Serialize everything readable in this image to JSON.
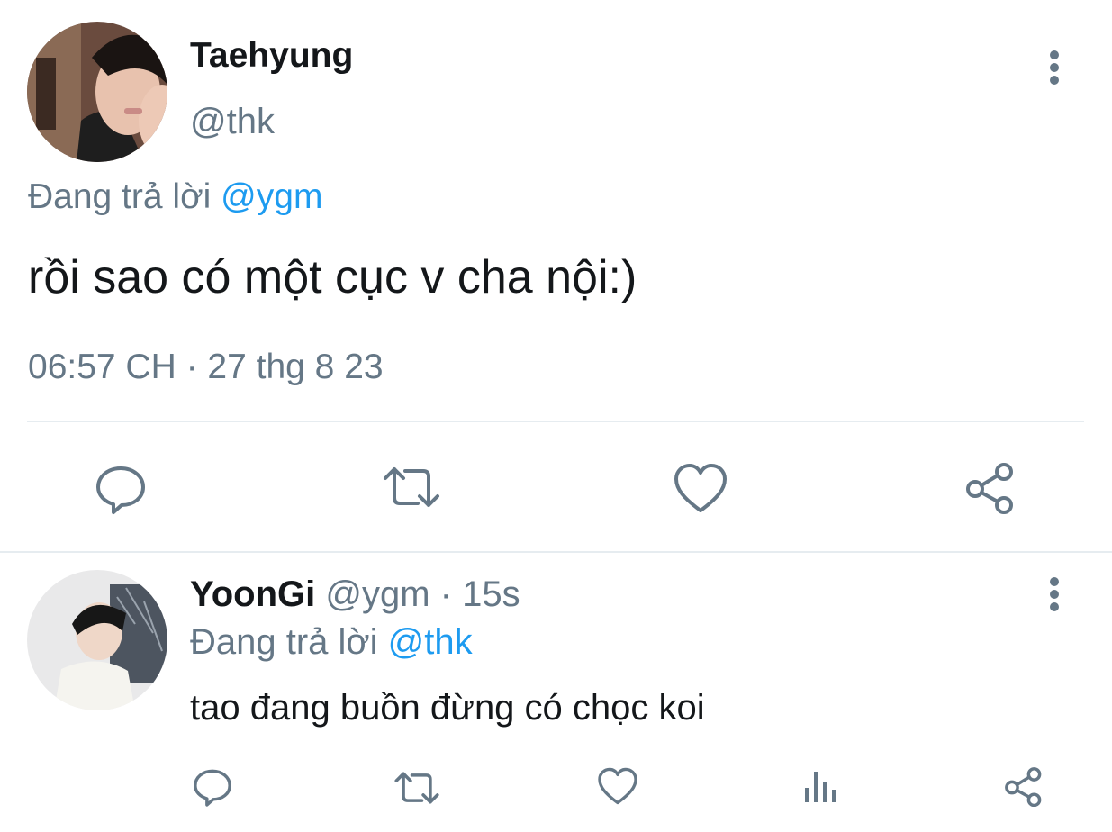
{
  "main_tweet": {
    "display_name": "Taehyung",
    "handle": "@thk",
    "reply_prefix": "Đang trả lời",
    "reply_to": "@ygm",
    "text": "rồi sao có một cục v cha nội:)",
    "timestamp": "06:57 CH · 27 thg 8 23",
    "actions": [
      "reply-icon",
      "retweet-icon",
      "like-icon",
      "share-icon"
    ]
  },
  "reply_tweet": {
    "display_name": "YoonGi",
    "meta": "@ygm · 15s",
    "reply_prefix": "Đang trả lời",
    "reply_to": "@thk",
    "text": "tao đang buồn đừng có chọc koi",
    "actions": [
      "reply-icon",
      "retweet-icon",
      "like-icon",
      "analytics-icon",
      "share-icon"
    ]
  },
  "colors": {
    "icon_gray": "#657786",
    "link_blue": "#1d9bf0",
    "divider": "#e6ecf0"
  }
}
